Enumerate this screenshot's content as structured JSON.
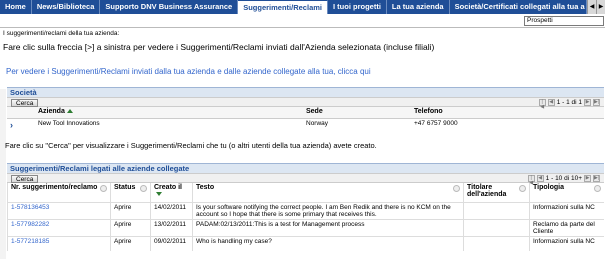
{
  "nav": {
    "tabs": [
      "Home",
      "News/Biblioteca",
      "Supporto DNV Business Assurance",
      "Suggerimenti/Reclami",
      "I tuoi progetti",
      "La tua azienda",
      "Società/Certificati collegati alla tua a"
    ],
    "active_index": 3
  },
  "prospetti": "Prospetti",
  "intro_label": "I suggerimenti/reclami della tua azienda:",
  "heading": "Fare clic sulla freccia [>] a sinistra per vedere i Suggerimenti/Reclami inviati dall'Azienda selezionata (incluse filiali)",
  "related_link": "Per vedere i Suggerimenti/Reclami inviati dalla tua azienda e dalle aziende collegate alla tua, clicca qui",
  "societa": {
    "title": "Società",
    "search_button": "Cerca",
    "pager": "1 - 1 di 1",
    "columns": [
      "Azienda",
      "Sede",
      "Telefono"
    ],
    "rows": [
      {
        "azienda": "New Tool Innovations",
        "sede": "Norway",
        "telefono": "+47 6757 9000"
      }
    ]
  },
  "instruction": "Fare clic su \"Cerca\" per visualizzare i Suggerimenti/Reclami che tu (o altri utenti della tua azienda) avete creato.",
  "suggerimenti": {
    "title": "Suggerimenti/Reclami legati alle aziende collegate",
    "search_button": "Cerca",
    "pager": "1 - 10 di 10+",
    "columns": [
      "Nr. suggerimento/reclamo",
      "Status",
      "Creato il",
      "Testo",
      "Titolare dell'azienda",
      "Tipologia"
    ],
    "rows": [
      {
        "nr": "1-578136453",
        "status": "Aprire",
        "created": "14/02/2011",
        "text": "Is your software notifying the correct people. I am Ben Redik and there is no KCM on the account so I hope that there is some primary that receives this.",
        "owner": "",
        "type": "Informazioni sulla NC"
      },
      {
        "nr": "1-577982282",
        "status": "Aprire",
        "created": "13/02/2011",
        "text": "PADAM:02/13/2011:This is a test for Management process",
        "owner": "",
        "type": "Reclamo da parte del Cliente"
      },
      {
        "nr": "1-577218185",
        "status": "Aprire",
        "created": "09/02/2011",
        "text": "Who is handling my case?",
        "owner": "",
        "type": "Informazioni sulla NC"
      }
    ]
  }
}
